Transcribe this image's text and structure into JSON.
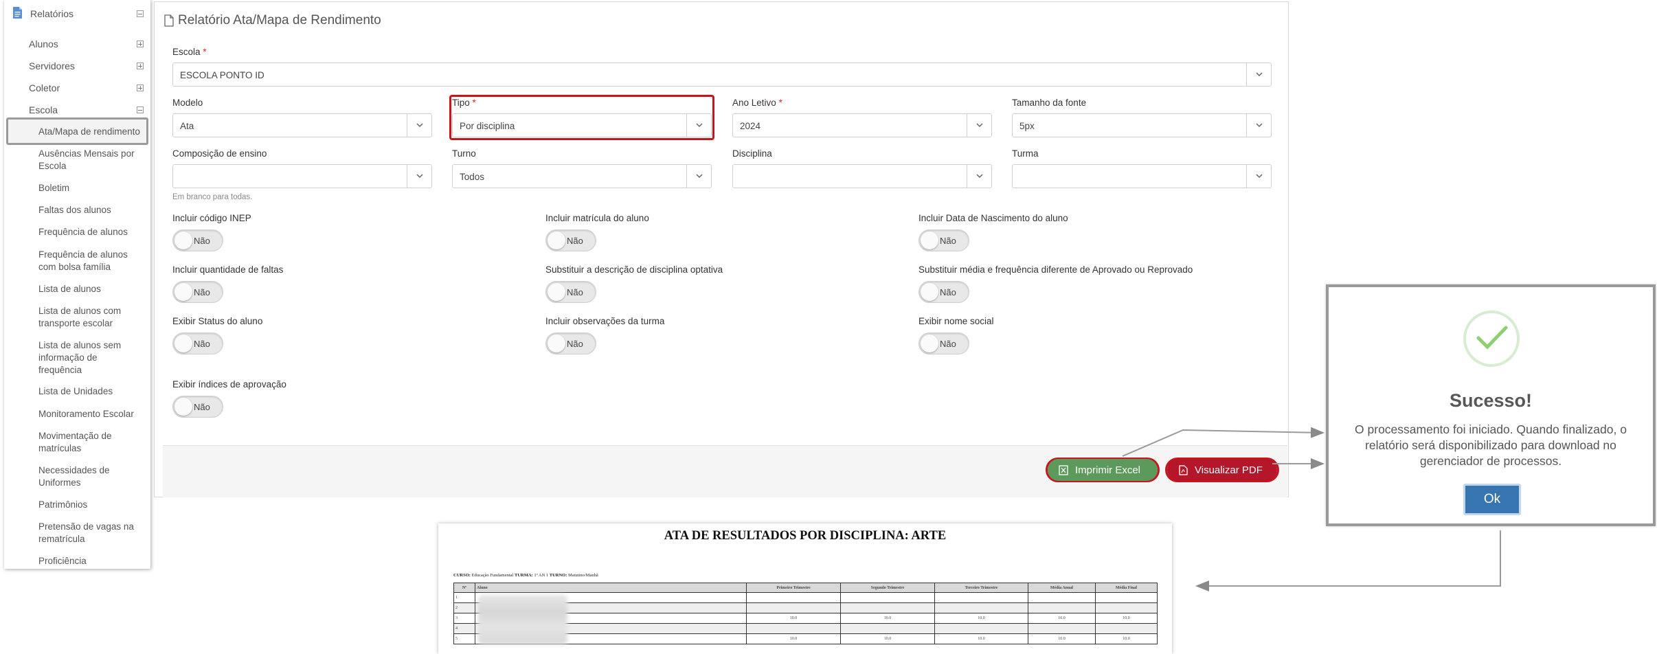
{
  "sidebar": {
    "header": "Relatórios",
    "groups": [
      {
        "label": "Alunos"
      },
      {
        "label": "Servidores"
      },
      {
        "label": "Coletor"
      },
      {
        "label": "Escola"
      }
    ],
    "items": [
      "Ata/Mapa de rendimento",
      "Ausências Mensais por Escola",
      "Boletim",
      "Faltas dos alunos",
      "Frequência de alunos",
      "Frequência de alunos com bolsa família",
      "Lista de alunos",
      "Lista de alunos com transporte escolar",
      "Lista de alunos sem informação de frequência",
      "Lista de Unidades",
      "Monitoramento Escolar",
      "Movimentação de matrículas",
      "Necessidades de Uniformes",
      "Patrimônios",
      "Pretensão de vagas na rematrícula",
      "Proficiência"
    ]
  },
  "form": {
    "title": "Relatório Ata/Mapa de Rendimento",
    "escola": {
      "label": "Escola",
      "value": "ESCOLA PONTO ID"
    },
    "modelo": {
      "label": "Modelo",
      "value": "Ata"
    },
    "tipo": {
      "label": "Tipo",
      "value": "Por disciplina"
    },
    "ano_letivo": {
      "label": "Ano Letivo",
      "value": "2024"
    },
    "tamanho_fonte": {
      "label": "Tamanho da fonte",
      "value": "5px"
    },
    "composicao": {
      "label": "Composição de ensino",
      "value": "",
      "hint": "Em branco para todas."
    },
    "turno": {
      "label": "Turno",
      "value": "Todos"
    },
    "disciplina": {
      "label": "Disciplina",
      "value": ""
    },
    "turma": {
      "label": "Turma",
      "value": ""
    },
    "required_mark": "*",
    "toggles": [
      {
        "label": "Incluir código INEP",
        "value": "Não"
      },
      {
        "label": "Incluir matrícula do aluno",
        "value": "Não"
      },
      {
        "label": "Incluir Data de Nascimento do aluno",
        "value": "Não"
      },
      {
        "label": "Incluir quantidade de faltas",
        "value": "Não"
      },
      {
        "label": "Substituir a descrição de disciplina optativa",
        "value": "Não"
      },
      {
        "label": "Substituir média e frequência diferente de Aprovado ou Reprovado",
        "value": "Não"
      },
      {
        "label": "Exibir Status do aluno",
        "value": "Não"
      },
      {
        "label": "Incluir observações da turma",
        "value": "Não"
      },
      {
        "label": "Exibir nome social",
        "value": "Não"
      },
      {
        "label": "Exibir índices de aprovação",
        "value": "Não"
      }
    ],
    "buttons": {
      "excel": "Imprimir Excel",
      "pdf": "Visualizar PDF"
    },
    "colors": {
      "excel": "#5c9a5c",
      "pdf": "#b5162a",
      "highlight": "#c8141c"
    }
  },
  "modal": {
    "title": "Sucesso!",
    "message": "O processamento foi iniciado. Quando finalizado, o relatório será disponibilizado para download no gerenciador de processos.",
    "ok": "Ok"
  },
  "report": {
    "title": "ATA DE RESULTADOS POR DISCIPLINA: ARTE",
    "meta": {
      "curso_label": "CURSO:",
      "curso": "Educação Fundamental",
      "turma_label": "TURMA:",
      "turma": "1º AN 1",
      "turno_label": "TURNO:",
      "turno": "Matutino/Manhã"
    },
    "columns": [
      "Nº",
      "Aluno",
      "Primeiro Trimestre",
      "Segundo Trimestre",
      "Terceiro Trimestre",
      "Média Anual",
      "Média Final"
    ],
    "rows": [
      [
        "1",
        "",
        "",
        "",
        "",
        "",
        ""
      ],
      [
        "2",
        "",
        "",
        "",
        "",
        "",
        ""
      ],
      [
        "3",
        "",
        "10.0",
        "10.0",
        "10.0",
        "10.0",
        "10.0"
      ],
      [
        "4",
        "",
        "",
        "",
        "",
        "",
        ""
      ],
      [
        "5",
        "",
        "10.0",
        "10.0",
        "10.0",
        "10.0",
        "10.0"
      ]
    ]
  }
}
